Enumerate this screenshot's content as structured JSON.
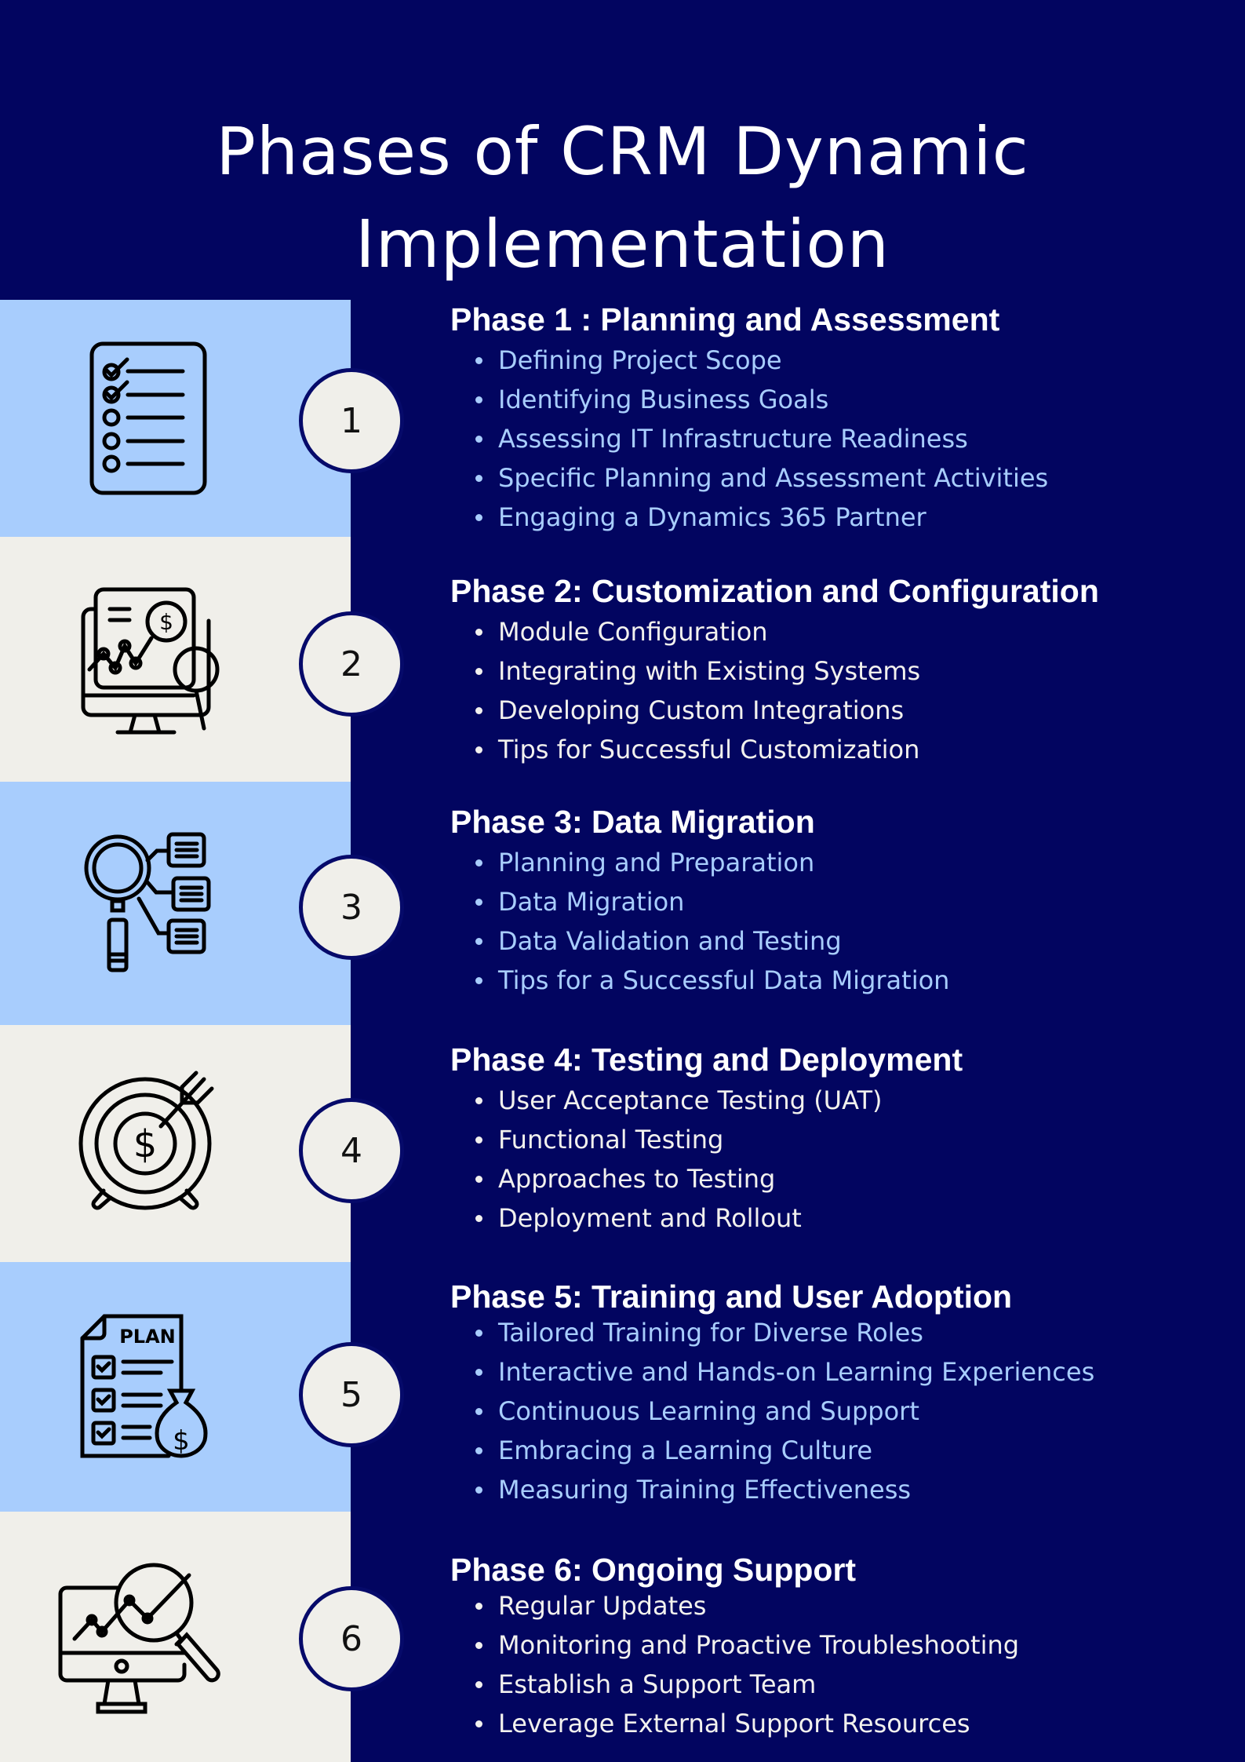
{
  "title": {
    "line1": "Phases of CRM Dynamic",
    "line2": "Implementation"
  },
  "colors": {
    "background": "#020560",
    "band_blue": "#a8cdfd",
    "band_cream": "#f0efea",
    "badge_fill": "#f0efea",
    "badge_border": "#060a6a",
    "heading_text": "#ffffff",
    "bullet_light_blue": "#a8cdfd",
    "bullet_white": "#f2f1ee"
  },
  "phases": [
    {
      "number": "1",
      "icon": "checklist-icon",
      "heading": "Phase 1 : Planning and Assessment",
      "items": [
        "Defining Project Scope",
        "Identifying Business Goals",
        "Assessing IT Infrastructure Readiness",
        "Specific Planning and Assessment Activities",
        "Engaging a Dynamics 365 Partner"
      ]
    },
    {
      "number": "2",
      "icon": "monitor-analytics-magnifier-icon",
      "heading": "Phase 2: Customization and Configuration",
      "items": [
        "Module Configuration",
        "Integrating with Existing Systems",
        "Developing Custom Integrations",
        "Tips for Successful Customization"
      ]
    },
    {
      "number": "3",
      "icon": "magnifier-data-blocks-icon",
      "heading": "Phase 3: Data Migration",
      "items": [
        "Planning and Preparation",
        "Data Migration",
        "Data Validation and Testing",
        "Tips for a Successful Data Migration"
      ]
    },
    {
      "number": "4",
      "icon": "target-dollar-arrow-icon",
      "heading": "Phase 4: Testing and Deployment",
      "items": [
        "User Acceptance Testing (UAT)",
        "Functional Testing",
        "Approaches to Testing",
        "Deployment and Rollout"
      ]
    },
    {
      "number": "5",
      "icon": "plan-document-money-bag-icon",
      "icon_label": "PLAN",
      "heading": "Phase 5: Training and User Adoption",
      "items": [
        "Tailored Training for Diverse Roles",
        "Interactive and Hands-on Learning Experiences",
        "Continuous Learning and Support",
        "Embracing a Learning Culture",
        "Measuring Training Effectiveness"
      ]
    },
    {
      "number": "6",
      "icon": "monitor-chart-magnifier-icon",
      "heading": "Phase 6: Ongoing Support",
      "items": [
        "Regular Updates",
        "Monitoring and Proactive Troubleshooting",
        "Establish a Support Team",
        "Leverage External Support Resources"
      ]
    }
  ]
}
